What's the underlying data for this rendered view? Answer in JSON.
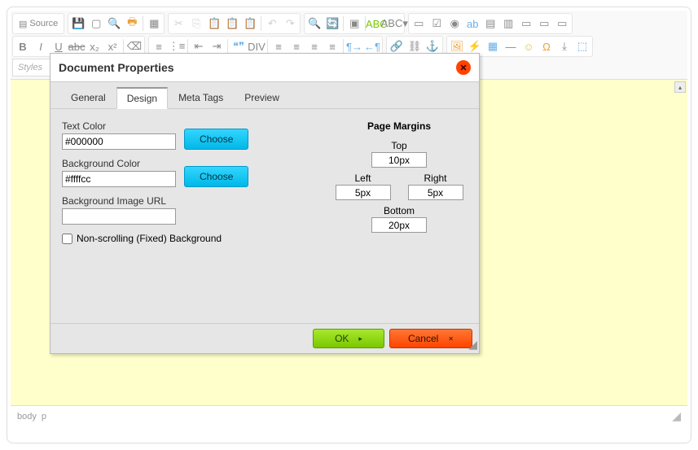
{
  "toolbar": {
    "source_label": "Source",
    "styles_placeholder": "Styles"
  },
  "dialog": {
    "title": "Document Properties",
    "tabs": [
      "General",
      "Design",
      "Meta Tags",
      "Preview"
    ],
    "active_tab": 1,
    "text_color_label": "Text Color",
    "text_color_value": "#000000",
    "bg_color_label": "Background Color",
    "bg_color_value": "#ffffcc",
    "bg_image_label": "Background Image URL",
    "bg_image_value": "",
    "choose_label": "Choose",
    "fixed_bg_label": "Non-scrolling (Fixed) Background",
    "fixed_bg_checked": false,
    "margins_title": "Page Margins",
    "margin_top_label": "Top",
    "margin_top_value": "10px",
    "margin_left_label": "Left",
    "margin_left_value": "5px",
    "margin_right_label": "Right",
    "margin_right_value": "5px",
    "margin_bottom_label": "Bottom",
    "margin_bottom_value": "20px",
    "ok_label": "OK",
    "cancel_label": "Cancel"
  },
  "status": {
    "path": [
      "body",
      "p"
    ]
  }
}
